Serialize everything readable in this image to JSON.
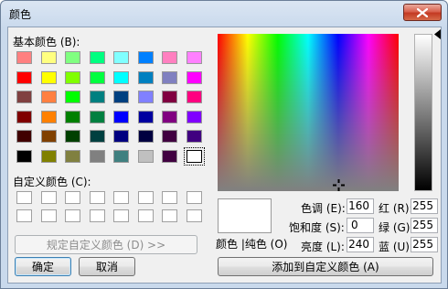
{
  "window": {
    "title": "颜色"
  },
  "basic": {
    "label": "基本颜色 (B):",
    "colors": [
      "#ff8080",
      "#ffff80",
      "#80ff80",
      "#00ff80",
      "#80ffff",
      "#0080ff",
      "#ff80c0",
      "#ff80ff",
      "#ff0000",
      "#ffff00",
      "#80ff00",
      "#00ff40",
      "#00ffff",
      "#0080c0",
      "#8080c0",
      "#ff00ff",
      "#804040",
      "#ff8040",
      "#00ff00",
      "#008080",
      "#004080",
      "#8080ff",
      "#800040",
      "#ff0080",
      "#800000",
      "#ff8000",
      "#008000",
      "#008040",
      "#0000ff",
      "#0000a0",
      "#800080",
      "#8000ff",
      "#400000",
      "#804000",
      "#004000",
      "#004040",
      "#000080",
      "#000040",
      "#400040",
      "#400080",
      "#000000",
      "#808000",
      "#808040",
      "#808080",
      "#408080",
      "#c0c0c0",
      "#400040",
      "#ffffff"
    ]
  },
  "custom": {
    "label": "自定义颜色 (C):",
    "count": 16
  },
  "buttons": {
    "define_custom": "规定自定义颜色 (D) >>",
    "ok": "确定",
    "cancel": "取消",
    "add_custom": "添加到自定义颜色 (A)"
  },
  "preview": {
    "label": "颜色 |纯色 (O)"
  },
  "hsl": {
    "hue_label": "色调 (E):",
    "hue": "160",
    "sat_label": "饱和度 (S):",
    "sat": "0",
    "lum_label": "亮度 (L):",
    "lum": "240"
  },
  "rgb": {
    "red_label": "红 (R):",
    "red": "255",
    "green_label": "绿 (G):",
    "green": "255",
    "blue_label": "蓝 (U):",
    "blue": "255"
  }
}
